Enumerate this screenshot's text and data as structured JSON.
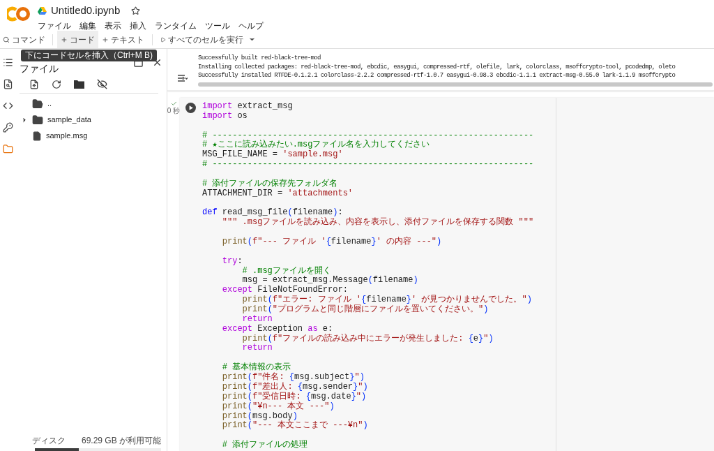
{
  "header": {
    "title": "Untitled0.ipynb",
    "starred": false,
    "menu": [
      "ファイル",
      "編集",
      "表示",
      "挿入",
      "ランタイム",
      "ツール",
      "ヘルプ"
    ]
  },
  "toolbar": {
    "search": "コマンド",
    "buttons": [
      {
        "label": "コード",
        "kind": "add",
        "hovered": true
      },
      {
        "label": "テキスト",
        "kind": "add",
        "hovered": false
      },
      {
        "label": "すべてのセルを実行",
        "kind": "run",
        "hovered": false
      }
    ]
  },
  "tooltip": "下にコードセルを挿入（Ctrl+M B)",
  "rail": [
    {
      "kind": "toc",
      "selected": false
    },
    {
      "kind": "search",
      "selected": false
    },
    {
      "kind": "code",
      "selected": false
    },
    {
      "kind": "secrets",
      "selected": false
    },
    {
      "kind": "files",
      "selected": true
    }
  ],
  "file_panel": {
    "title": "ファイル",
    "tree": [
      {
        "name": "..",
        "kind": "parent"
      },
      {
        "name": "sample_data",
        "kind": "folder",
        "expanded": false
      },
      {
        "name": "sample.msg",
        "kind": "file"
      }
    ],
    "disk": {
      "label": "ディスク",
      "free": "69.29 GB が利用可能",
      "level": 0.35
    }
  },
  "output": {
    "lines": [
      "Successfully built red-black-tree-mod",
      "Installing collected packages: red-black-tree-mod, ebcdic, easygui, compressed-rtf, olefile, lark, colorclass, msoffcrypto-tool, pcodedmp, oleto",
      "Successfully installed RTFDE-0.1.2.1 colorclass-2.2.2 compressed-rtf-1.0.7 easygui-0.98.3 ebcdic-1.1.1 extract-msg-0.55.0 lark-1.1.9 msoffcrypto"
    ]
  },
  "cell": {
    "done": true,
    "status": "0 秒",
    "lines": [
      {
        "kind": "code",
        "tokens": [
          {
            "kind": "keyword",
            "text": "import"
          },
          {
            "kind": "plain",
            "text": " extract_msg"
          }
        ]
      },
      {
        "kind": "code",
        "tokens": [
          {
            "kind": "keyword",
            "text": "import"
          },
          {
            "kind": "plain",
            "text": " os"
          }
        ]
      },
      {
        "kind": "blank"
      },
      {
        "kind": "code",
        "tokens": [
          {
            "kind": "comment",
            "text": "# ----------------------------------------------------------------"
          }
        ]
      },
      {
        "kind": "code",
        "tokens": [
          {
            "kind": "comment",
            "text": "# ★ここに読み込みたい.msgファイル名を入力してください"
          }
        ]
      },
      {
        "kind": "code",
        "tokens": [
          {
            "kind": "plain",
            "text": "MSG_FILE_NAME = "
          },
          {
            "kind": "string",
            "text": "'sample.msg'"
          }
        ]
      },
      {
        "kind": "code",
        "tokens": [
          {
            "kind": "comment",
            "text": "# ----------------------------------------------------------------"
          }
        ]
      },
      {
        "kind": "blank"
      },
      {
        "kind": "code",
        "tokens": [
          {
            "kind": "comment",
            "text": "# 添付ファイルの保存先フォルダ名"
          }
        ]
      },
      {
        "kind": "code",
        "tokens": [
          {
            "kind": "plain",
            "text": "ATTACHMENT_DIR = "
          },
          {
            "kind": "string",
            "text": "'attachments'"
          }
        ]
      },
      {
        "kind": "blank"
      },
      {
        "kind": "code",
        "tokens": [
          {
            "kind": "def",
            "text": "def"
          },
          {
            "kind": "plain",
            "text": " read_msg_file"
          },
          {
            "kind": "paren",
            "text": "("
          },
          {
            "kind": "plain",
            "text": "filename"
          },
          {
            "kind": "paren",
            "text": ")"
          },
          {
            "kind": "plain",
            "text": ":"
          }
        ]
      },
      {
        "kind": "code",
        "tokens": [
          {
            "kind": "string",
            "text": "    \"\"\" .msgファイルを読み込み、内容を表示し、添付ファイルを保存する関数 \"\"\""
          }
        ]
      },
      {
        "kind": "blank"
      },
      {
        "kind": "code",
        "tokens": [
          {
            "kind": "builtin",
            "text": "    print"
          },
          {
            "kind": "paren",
            "text": "("
          },
          {
            "kind": "string",
            "text": "f\"--- ファイル '"
          },
          {
            "kind": "paren",
            "text": "{"
          },
          {
            "kind": "plain",
            "text": "filename"
          },
          {
            "kind": "paren",
            "text": "}"
          },
          {
            "kind": "string",
            "text": "' の内容 ---\""
          },
          {
            "kind": "paren",
            "text": ")"
          }
        ]
      },
      {
        "kind": "blank"
      },
      {
        "kind": "code",
        "tokens": [
          {
            "kind": "keyword",
            "text": "    try"
          },
          {
            "kind": "plain",
            "text": ":"
          }
        ]
      },
      {
        "kind": "code",
        "tokens": [
          {
            "kind": "comment",
            "text": "        # .msgファイルを開く"
          }
        ]
      },
      {
        "kind": "code",
        "tokens": [
          {
            "kind": "plain",
            "text": "        msg = extract_msg.Message"
          },
          {
            "kind": "paren",
            "text": "("
          },
          {
            "kind": "plain",
            "text": "filename"
          },
          {
            "kind": "paren",
            "text": ")"
          }
        ]
      },
      {
        "kind": "code",
        "tokens": [
          {
            "kind": "keyword",
            "text": "    except"
          },
          {
            "kind": "plain",
            "text": " FileNotFoundError:"
          }
        ]
      },
      {
        "kind": "code",
        "tokens": [
          {
            "kind": "builtin",
            "text": "        print"
          },
          {
            "kind": "paren",
            "text": "("
          },
          {
            "kind": "string",
            "text": "f\"エラー: ファイル '"
          },
          {
            "kind": "paren",
            "text": "{"
          },
          {
            "kind": "plain",
            "text": "filename"
          },
          {
            "kind": "paren",
            "text": "}"
          },
          {
            "kind": "string",
            "text": "' が見つかりませんでした。\""
          },
          {
            "kind": "paren",
            "text": ")"
          }
        ]
      },
      {
        "kind": "code",
        "tokens": [
          {
            "kind": "builtin",
            "text": "        print"
          },
          {
            "kind": "paren",
            "text": "("
          },
          {
            "kind": "string",
            "text": "\"プログラムと同じ階層にファイルを置いてください。\""
          },
          {
            "kind": "paren",
            "text": ")"
          }
        ]
      },
      {
        "kind": "code",
        "tokens": [
          {
            "kind": "keyword",
            "text": "        return"
          }
        ]
      },
      {
        "kind": "code",
        "tokens": [
          {
            "kind": "keyword",
            "text": "    except"
          },
          {
            "kind": "plain",
            "text": " Exception "
          },
          {
            "kind": "keyword",
            "text": "as"
          },
          {
            "kind": "plain",
            "text": " e:"
          }
        ]
      },
      {
        "kind": "code",
        "tokens": [
          {
            "kind": "builtin",
            "text": "        print"
          },
          {
            "kind": "paren",
            "text": "("
          },
          {
            "kind": "string",
            "text": "f\"ファイルの読み込み中にエラーが発生しました: "
          },
          {
            "kind": "paren",
            "text": "{"
          },
          {
            "kind": "plain",
            "text": "e"
          },
          {
            "kind": "paren",
            "text": "}"
          },
          {
            "kind": "string",
            "text": "\""
          },
          {
            "kind": "paren",
            "text": ")"
          }
        ]
      },
      {
        "kind": "code",
        "tokens": [
          {
            "kind": "keyword",
            "text": "        return"
          }
        ]
      },
      {
        "kind": "blank"
      },
      {
        "kind": "code",
        "tokens": [
          {
            "kind": "comment",
            "text": "    # 基本情報の表示"
          }
        ]
      },
      {
        "kind": "code",
        "tokens": [
          {
            "kind": "builtin",
            "text": "    print"
          },
          {
            "kind": "paren",
            "text": "("
          },
          {
            "kind": "string",
            "text": "f\"件名: "
          },
          {
            "kind": "paren",
            "text": "{"
          },
          {
            "kind": "plain",
            "text": "msg.subject"
          },
          {
            "kind": "paren",
            "text": "}"
          },
          {
            "kind": "string",
            "text": "\""
          },
          {
            "kind": "paren",
            "text": ")"
          }
        ]
      },
      {
        "kind": "code",
        "tokens": [
          {
            "kind": "builtin",
            "text": "    print"
          },
          {
            "kind": "paren",
            "text": "("
          },
          {
            "kind": "string",
            "text": "f\"差出人: "
          },
          {
            "kind": "paren",
            "text": "{"
          },
          {
            "kind": "plain",
            "text": "msg.sender"
          },
          {
            "kind": "paren",
            "text": "}"
          },
          {
            "kind": "string",
            "text": "\""
          },
          {
            "kind": "paren",
            "text": ")"
          }
        ]
      },
      {
        "kind": "code",
        "tokens": [
          {
            "kind": "builtin",
            "text": "    print"
          },
          {
            "kind": "paren",
            "text": "("
          },
          {
            "kind": "string",
            "text": "f\"受信日時: "
          },
          {
            "kind": "paren",
            "text": "{"
          },
          {
            "kind": "plain",
            "text": "msg.date"
          },
          {
            "kind": "paren",
            "text": "}"
          },
          {
            "kind": "string",
            "text": "\""
          },
          {
            "kind": "paren",
            "text": ")"
          }
        ]
      },
      {
        "kind": "code",
        "tokens": [
          {
            "kind": "builtin",
            "text": "    print"
          },
          {
            "kind": "paren",
            "text": "("
          },
          {
            "kind": "string",
            "text": "\"¥n--- 本文 ---\""
          },
          {
            "kind": "paren",
            "text": ")"
          }
        ]
      },
      {
        "kind": "code",
        "tokens": [
          {
            "kind": "builtin",
            "text": "    print"
          },
          {
            "kind": "paren",
            "text": "("
          },
          {
            "kind": "plain",
            "text": "msg.body"
          },
          {
            "kind": "paren",
            "text": ")"
          }
        ]
      },
      {
        "kind": "code",
        "tokens": [
          {
            "kind": "builtin",
            "text": "    print"
          },
          {
            "kind": "paren",
            "text": "("
          },
          {
            "kind": "string",
            "text": "\"--- 本文ここまで ---¥n\""
          },
          {
            "kind": "paren",
            "text": ")"
          }
        ]
      },
      {
        "kind": "blank"
      },
      {
        "kind": "code",
        "tokens": [
          {
            "kind": "comment",
            "text": "    # 添付ファイルの処理"
          }
        ]
      }
    ]
  }
}
